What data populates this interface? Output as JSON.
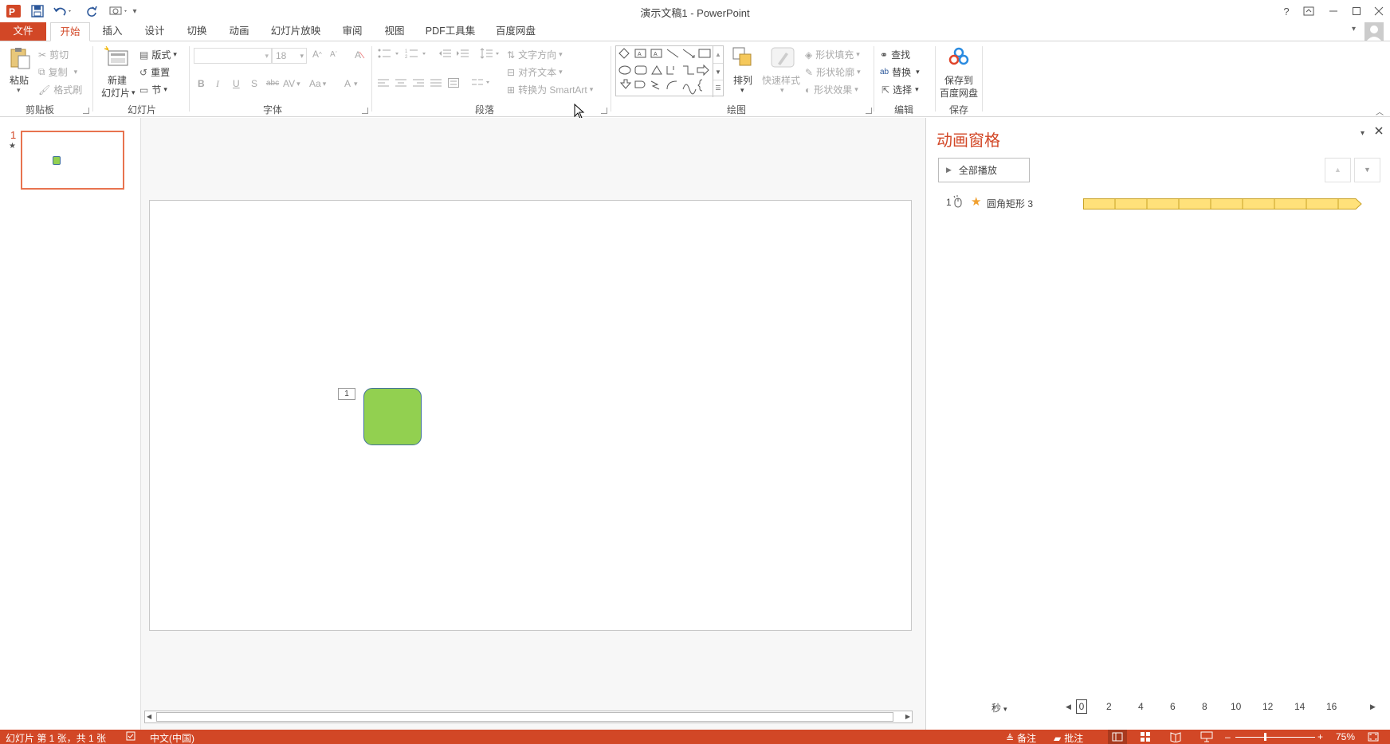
{
  "app": {
    "title": "演示文稿1 - PowerPoint",
    "logo_letter": "P",
    "help": "?"
  },
  "tabs": [
    "文件",
    "开始",
    "插入",
    "设计",
    "切换",
    "动画",
    "幻灯片放映",
    "审阅",
    "视图",
    "PDF工具集",
    "百度网盘"
  ],
  "ribbon": {
    "clipboard": {
      "label": "剪贴板",
      "paste": "粘贴",
      "cut": "剪切",
      "copy": "复制",
      "format_painter": "格式刷"
    },
    "slides": {
      "label": "幻灯片",
      "new_slide_line1": "新建",
      "new_slide_line2": "幻灯片",
      "layout": "版式",
      "reset": "重置",
      "section": "节"
    },
    "font": {
      "label": "字体",
      "font_name": "",
      "font_size": "18",
      "bold": "B",
      "italic": "I",
      "underline": "U",
      "shadow": "S",
      "strike": "abc",
      "spacing": "AV",
      "case": "Aa",
      "color": "A"
    },
    "paragraph": {
      "label": "段落",
      "text_direction": "文字方向",
      "align_text": "对齐文本",
      "smartart": "转换为 SmartArt"
    },
    "drawing": {
      "label": "绘图",
      "arrange": "排列",
      "quick_styles": "快速样式",
      "shape_fill": "形状填充",
      "shape_outline": "形状轮廓",
      "shape_effects": "形状效果"
    },
    "editing": {
      "label": "编辑",
      "find": "查找",
      "replace": "替换",
      "select": "选择"
    },
    "save": {
      "label": "保存",
      "save_line1": "保存到",
      "save_line2": "百度网盘"
    }
  },
  "thumbnails": [
    {
      "number": "1",
      "anim_marker": "★"
    }
  ],
  "slide": {
    "anim_tag": "1",
    "shape_color": "#92d050",
    "shape_border": "#41719c"
  },
  "anim_pane": {
    "title": "动画窗格",
    "play_all": "全部播放",
    "items": [
      {
        "index": "1",
        "name": "圆角矩形 3"
      }
    ],
    "seconds_label": "秒",
    "timeline_ticks": [
      "0",
      "2",
      "4",
      "6",
      "8",
      "10",
      "12",
      "14",
      "16"
    ]
  },
  "statusbar": {
    "slide_info": "幻灯片 第 1 张，共 1 张",
    "language": "中文(中国)",
    "notes": "备注",
    "comments": "批注",
    "zoom": "75%"
  },
  "colors": {
    "accent": "#d24726",
    "anim_bar": "#ffe17a",
    "anim_bar_border": "#c9a227"
  }
}
